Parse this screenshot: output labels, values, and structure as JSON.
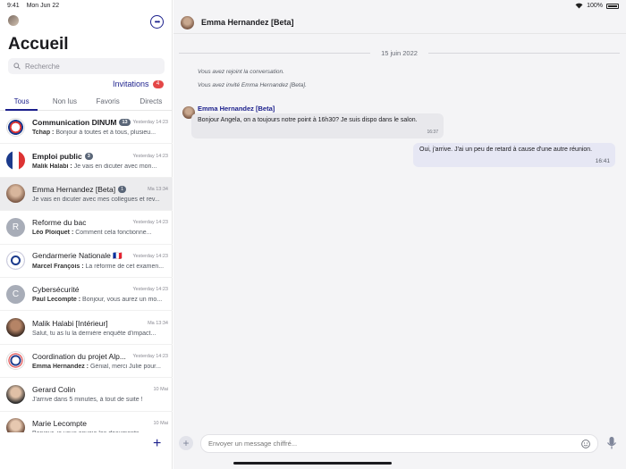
{
  "status": {
    "time": "9:41",
    "date": "Mon Jun 22",
    "battery": "100%"
  },
  "sidebar": {
    "title": "Accueil",
    "search_placeholder": "Recherche",
    "invitations_label": "Invitations",
    "invitations_count": "4",
    "tabs": [
      {
        "label": "Tous",
        "active": true
      },
      {
        "label": "Non lus",
        "active": false
      },
      {
        "label": "Favoris",
        "active": false
      },
      {
        "label": "Directs",
        "active": false
      }
    ],
    "rooms": [
      {
        "name": "Communication DINUM",
        "badge": "13",
        "time": "Yesterday 14:23",
        "sender": "Tchap :",
        "preview": "Bonjour à toutes et à tous, plusieu...",
        "unread": true,
        "avatar": "logo"
      },
      {
        "name": "Emploi public",
        "badge": "3",
        "time": "Yesterday 14:23",
        "sender": "Malik Halabi :",
        "preview": "Je vais en dicuter avec mon...",
        "unread": true,
        "avatar": "flag"
      },
      {
        "name": "Emma Hernandez [Beta]",
        "badge": "1",
        "time": "Ma 13:34",
        "sender": "",
        "preview": "Je vais en dicuter avec mes collegues et rev...",
        "unread": false,
        "avatar": "photo",
        "selected": true
      },
      {
        "name": "Reforme du bac",
        "badge": "",
        "time": "Yesterday 14:23",
        "sender": "Léo Ploiquet :",
        "preview": "Comment cela fonctionne...",
        "unread": false,
        "avatar": "R"
      },
      {
        "name": "Gendarmerie Nationale 🇫🇷",
        "badge": "",
        "time": "Yesterday 14:23",
        "sender": "Marcel François :",
        "preview": "La réforme de cet examen...",
        "unread": false,
        "avatar": "gendarmerie"
      },
      {
        "name": "Cybersécurité",
        "badge": "",
        "time": "Yesterday 14:23",
        "sender": "Paul Lecompte :",
        "preview": "Bonjour, vous aurez un mo...",
        "unread": false,
        "avatar": "C"
      },
      {
        "name": "Malik Halabi [Intérieur]",
        "badge": "",
        "time": "Ma 13:34",
        "sender": "",
        "preview": "Salut, tu as lu la dernière enquête d'impact...",
        "unread": false,
        "avatar": "photo2"
      },
      {
        "name": "Coordination du projet Alp...",
        "badge": "",
        "time": "Yesterday 14:23",
        "sender": "Emma Hernandez :",
        "preview": "Génial, merci Julie pour...",
        "unread": false,
        "avatar": "logo2"
      },
      {
        "name": "Gerard Colin",
        "badge": "",
        "time": "10 Mai",
        "sender": "",
        "preview": "J'arrive dans 5 minutes, à tout de suite !",
        "unread": false,
        "avatar": "photo3"
      },
      {
        "name": "Marie Lecompte",
        "badge": "",
        "time": "10 Mai",
        "sender": "",
        "preview": "Bonjour, je vous envoie les documents...",
        "unread": false,
        "avatar": "photo4"
      }
    ]
  },
  "chat": {
    "title": "Emma Hernandez [Beta]",
    "date_separator": "15 juin 2022",
    "notices": [
      "Vous avez rejoint la conversation.",
      "Vous avez invité Emma Hernandez [Beta]."
    ],
    "incoming": {
      "sender": "Emma Hernandez [Beta]",
      "text": "Bonjour Angela, on a toujours notre point à 16h30? Je suis dispo dans le salon.",
      "time": "16:37"
    },
    "outgoing": {
      "text": "Oui, j'arrive. J'ai un peu de retard à cause d'une autre réunion.",
      "time": "16:41"
    },
    "composer_placeholder": "Envoyer un message chiffré..."
  },
  "colors": {
    "accent": "#1b1f8c",
    "badge_red": "#e44747"
  }
}
